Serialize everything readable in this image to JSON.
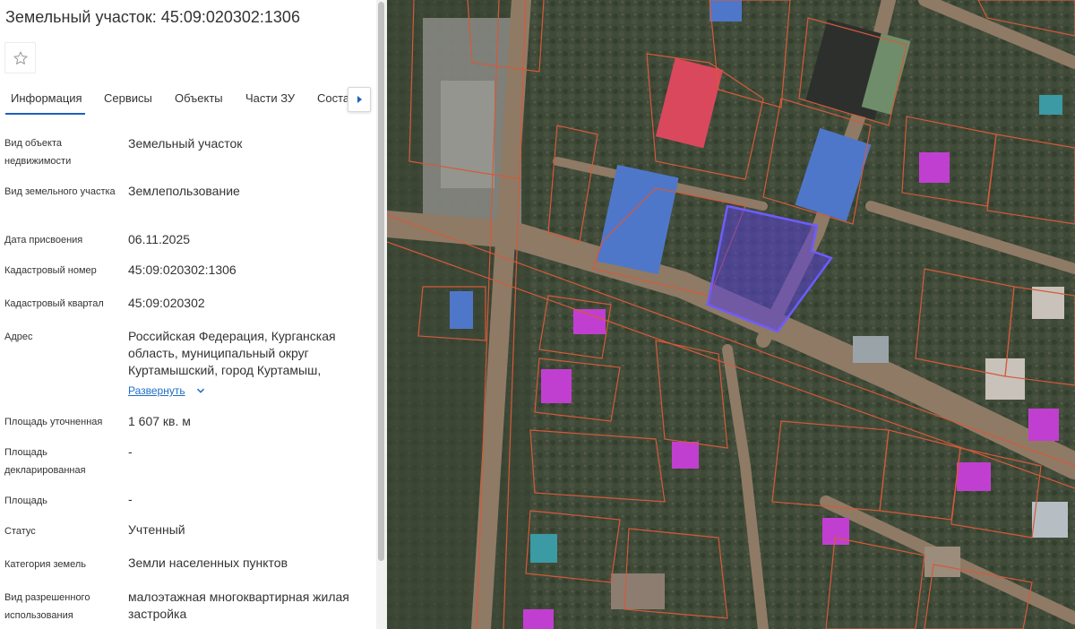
{
  "header": {
    "title": "Земельный участок: 45:09:020302:1306"
  },
  "tabs": [
    {
      "label": "Информация",
      "active": true
    },
    {
      "label": "Сервисы"
    },
    {
      "label": "Объекты"
    },
    {
      "label": "Части ЗУ"
    },
    {
      "label": "Соста"
    }
  ],
  "details": {
    "object_type": {
      "label": "Вид объекта недвижимости",
      "value": "Земельный участок"
    },
    "land_plot_type": {
      "label": "Вид земельного участка",
      "value": "Землепользование"
    },
    "assigned_date": {
      "label": "Дата присвоения",
      "value": "06.11.2025"
    },
    "cadastral_number": {
      "label": "Кадастровый номер",
      "value": "45:09:020302:1306"
    },
    "cadastral_quarter": {
      "label": "Кадастровый квартал",
      "value": "45:09:020302"
    },
    "address": {
      "label": "Адрес",
      "value": "Российская Федерация, Курганская область, муниципальный округ Куртамышский, город Куртамыш,",
      "expand_label": "Развернуть"
    },
    "area_specified": {
      "label": "Площадь уточненная",
      "value": "1 607 кв. м"
    },
    "area_declared": {
      "label": "Площадь декларированная",
      "value": "-"
    },
    "area": {
      "label": "Площадь",
      "value": "-"
    },
    "status": {
      "label": "Статус",
      "value": "Учтенный"
    },
    "land_category": {
      "label": "Категория земель",
      "value": "Земли населенных пунктов"
    },
    "permitted_use": {
      "label": "Вид разрешенного использования",
      "value": "малоэтажная многоквартирная жилая застройка"
    }
  },
  "icons": {
    "favorite": "star-icon",
    "tabs_next": "triangle-right-icon",
    "expand": "chevron-down-icon"
  },
  "colors": {
    "accent": "#1f5fbf",
    "link": "#1f6fc5",
    "parcel_border": "#d45a3a",
    "selected_parcel": "#5a3fd6",
    "building_blue": "#4f77c9",
    "building_magenta": "#c13fd0",
    "building_red": "#d9485c",
    "building_teal": "#3b9aa3"
  }
}
